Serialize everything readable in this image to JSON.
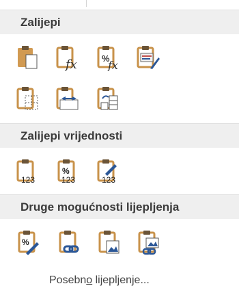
{
  "sections": [
    {
      "title": "Zalijepi",
      "icons": [
        "paste-icon",
        "paste-formulas-icon",
        "paste-formulas-number-format-icon",
        "keep-source-formatting-icon",
        "no-borders-icon",
        "keep-column-widths-icon",
        "transpose-icon"
      ]
    },
    {
      "title": "Zalijepi vrijednosti",
      "icons": [
        "values-icon",
        "values-number-format-icon",
        "values-source-formatting-icon"
      ]
    },
    {
      "title": "Druge mogućnosti lijepljenja",
      "icons": [
        "formatting-icon",
        "paste-link-icon",
        "picture-icon",
        "linked-picture-icon"
      ]
    }
  ],
  "footer": {
    "before": "Posebn",
    "underlined": "o",
    "after": " lijepljenje..."
  },
  "icon_text": {
    "fx": "fx",
    "percent": "%",
    "num": "123"
  },
  "colors": {
    "clipboard": "#c8924a",
    "clipboard_dark": "#8b6a3a",
    "header_bg": "#efefef",
    "accent_blue": "#2b5797"
  }
}
